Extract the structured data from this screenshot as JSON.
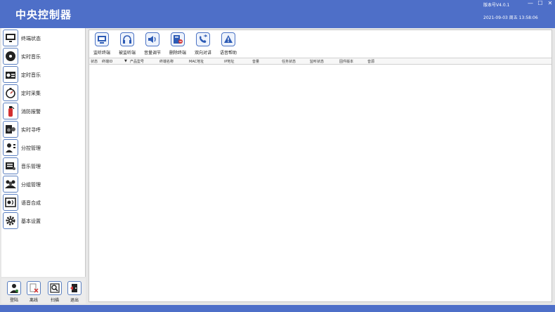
{
  "title": "中央控制器",
  "version": "版本号V4.0.1",
  "datetime": "2021-09-03  周五  13:58:06",
  "window_controls": {
    "minimize": "—",
    "maximize": "☐",
    "close": "✕"
  },
  "sidebar": {
    "items": [
      {
        "label": "终端状态",
        "icon": "monitor-icon"
      },
      {
        "label": "实时音乐",
        "icon": "music-disc-icon"
      },
      {
        "label": "定时音乐",
        "icon": "radio-icon"
      },
      {
        "label": "定时采集",
        "icon": "stopwatch-icon"
      },
      {
        "label": "消防报警",
        "icon": "fire-extinguisher-icon"
      },
      {
        "label": "实时寻呼",
        "icon": "speaker-icon"
      },
      {
        "label": "分控管理",
        "icon": "user-control-icon"
      },
      {
        "label": "音乐管理",
        "icon": "music-manage-icon"
      },
      {
        "label": "分组管理",
        "icon": "group-icon"
      },
      {
        "label": "语音合成",
        "icon": "tts-icon"
      },
      {
        "label": "基本设置",
        "icon": "gear-icon"
      }
    ]
  },
  "bottom_buttons": [
    {
      "label": "登陆",
      "icon": "login-user-icon"
    },
    {
      "label": "离线",
      "icon": "offline-icon"
    },
    {
      "label": "扫描",
      "icon": "scan-icon"
    },
    {
      "label": "退出",
      "icon": "exit-icon"
    }
  ],
  "toolbar": [
    {
      "label": "监听终端",
      "icon": "monitor-terminal-icon"
    },
    {
      "label": "被监听端",
      "icon": "headset-icon"
    },
    {
      "label": "音量调节",
      "icon": "volume-icon"
    },
    {
      "label": "删除终端",
      "icon": "delete-terminal-icon"
    },
    {
      "label": "双向对讲",
      "icon": "intercom-icon"
    },
    {
      "label": "语音帮助",
      "icon": "help-warning-icon"
    }
  ],
  "table": {
    "columns": [
      "状态",
      "终端ID",
      "产品型号",
      "终端名称",
      "MAC地址",
      "IP地址",
      "音量",
      "任务状态",
      "监听状态",
      "固件版本",
      "音源"
    ],
    "sort_indicator": "▼",
    "rows": []
  },
  "colors": {
    "accent": "#4e6fc8",
    "icon_border": "#4a72c4"
  }
}
